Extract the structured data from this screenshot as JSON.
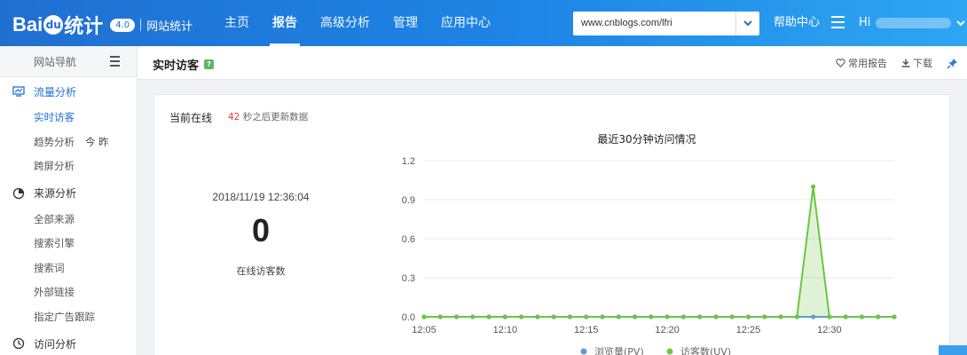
{
  "header": {
    "logo_pre": "Bai",
    "logo_paw": "du",
    "logo_post": "统计",
    "logo_badge": "4.0",
    "logo_sub": "网站统计",
    "nav": [
      {
        "label": "主页",
        "active": false
      },
      {
        "label": "报告",
        "active": true
      },
      {
        "label": "高级分析",
        "active": false
      },
      {
        "label": "管理",
        "active": false
      },
      {
        "label": "应用中心",
        "active": false
      }
    ],
    "site_value": "www.cnblogs.com/lfri",
    "help": "帮助中心",
    "user_prefix": "Hi"
  },
  "sidebar": {
    "title": "网站导航",
    "groups": [
      {
        "label": "流量分析",
        "icon": "monitor-icon",
        "active": true,
        "items": [
          {
            "label": "实时访客",
            "active": true
          },
          {
            "label": "趋势分析",
            "extra": "今  昨",
            "active": false
          },
          {
            "label": "跨屏分析",
            "active": false
          }
        ]
      },
      {
        "label": "来源分析",
        "icon": "pie-icon",
        "active": false,
        "items": [
          {
            "label": "全部来源"
          },
          {
            "label": "搜索引擎"
          },
          {
            "label": "搜索词"
          },
          {
            "label": "外部链接"
          },
          {
            "label": "指定广告跟踪"
          }
        ]
      },
      {
        "label": "访问分析",
        "icon": "clock-icon",
        "active": false,
        "items": []
      }
    ]
  },
  "page": {
    "title": "实时访客",
    "help_badge": "?",
    "actions": {
      "favorite": "常用报告",
      "download": "下载"
    }
  },
  "online": {
    "title": "当前在线",
    "refresh_seconds": "42",
    "refresh_text": " 秒之后更新数据",
    "datetime": "2018/11/19 12:36:04",
    "count": "0",
    "count_label": "在线访客数"
  },
  "chart_data": {
    "type": "line",
    "title": "最近30分钟访问情况",
    "ylim": [
      0,
      1.2
    ],
    "yticks": [
      "0.0",
      "0.3",
      "0.6",
      "0.9",
      "1.2"
    ],
    "xtick_labels": [
      "12:05",
      "12:10",
      "12:15",
      "12:20",
      "12:25",
      "12:30"
    ],
    "x_start": "12:05",
    "x_end": "12:34",
    "grid": true,
    "legend_position": "bottom",
    "series": [
      {
        "name": "浏览量(PV)",
        "color": "#5b9bd5",
        "values": [
          0,
          0,
          0,
          0,
          0,
          0,
          0,
          0,
          0,
          0,
          0,
          0,
          0,
          0,
          0,
          0,
          0,
          0,
          0,
          0,
          0,
          0,
          0,
          0,
          0,
          0,
          0,
          0,
          0,
          0
        ]
      },
      {
        "name": "访客数(UV)",
        "color": "#6cc644",
        "values": [
          0,
          0,
          0,
          0,
          0,
          0,
          0,
          0,
          0,
          0,
          0,
          0,
          0,
          0,
          0,
          0,
          0,
          0,
          0,
          0,
          0,
          0,
          0,
          0,
          1,
          0,
          0,
          0,
          0,
          0
        ]
      }
    ]
  }
}
